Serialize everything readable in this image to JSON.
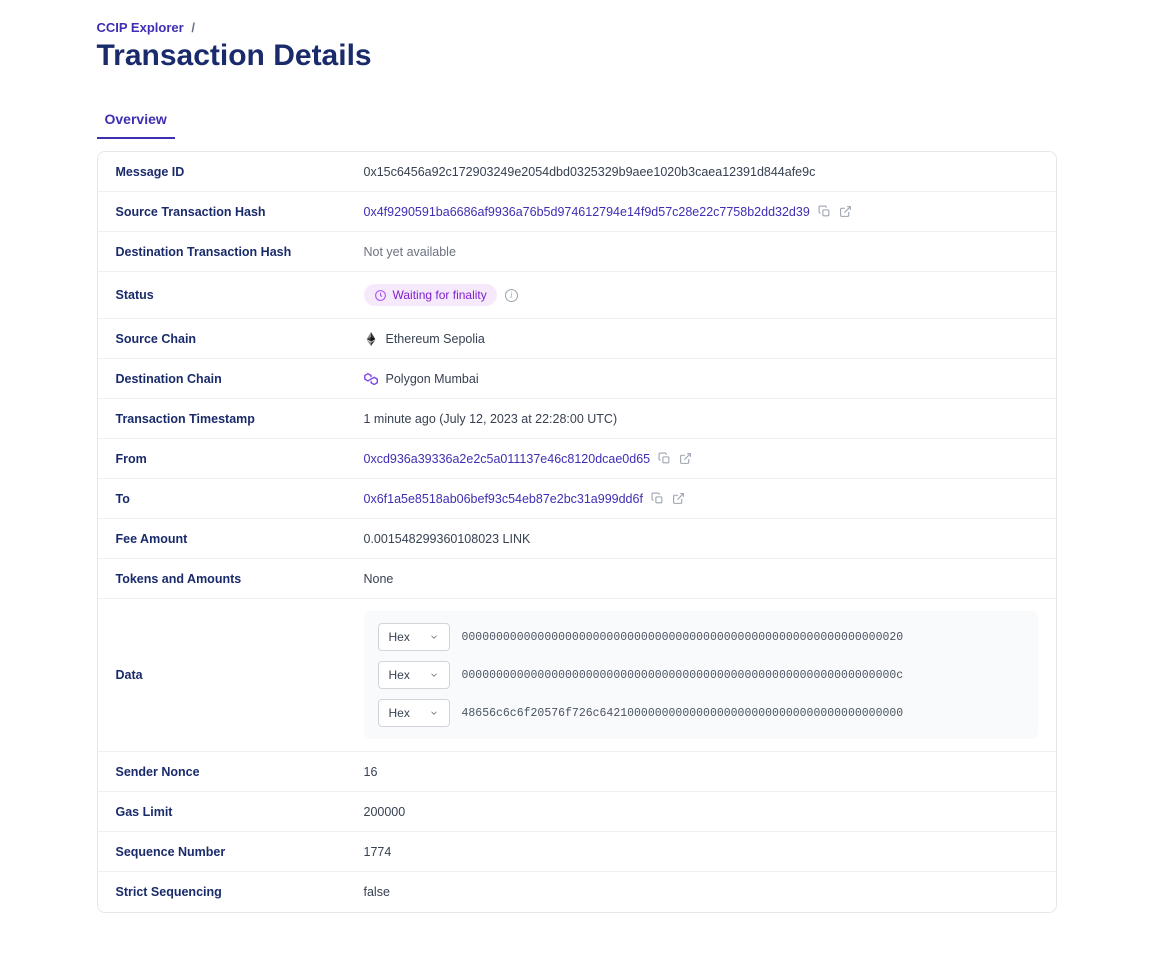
{
  "breadcrumb": {
    "root": "CCIP Explorer",
    "sep": "/"
  },
  "page_title": "Transaction Details",
  "tabs": {
    "overview": "Overview"
  },
  "labels": {
    "message_id": "Message ID",
    "source_tx_hash": "Source Transaction Hash",
    "dest_tx_hash": "Destination Transaction Hash",
    "status": "Status",
    "source_chain": "Source Chain",
    "dest_chain": "Destination Chain",
    "tx_timestamp": "Transaction Timestamp",
    "from": "From",
    "to": "To",
    "fee_amount": "Fee Amount",
    "tokens_amounts": "Tokens and Amounts",
    "data": "Data",
    "sender_nonce": "Sender Nonce",
    "gas_limit": "Gas Limit",
    "sequence_number": "Sequence Number",
    "strict_sequencing": "Strict Sequencing"
  },
  "values": {
    "message_id": "0x15c6456a92c172903249e2054dbd0325329b9aee1020b3caea12391d844afe9c",
    "source_tx_hash": "0x4f9290591ba6686af9936a76b5d974612794e14f9d57c28e22c7758b2dd32d39",
    "dest_tx_hash": "Not yet available",
    "status": "Waiting for finality",
    "source_chain": "Ethereum Sepolia",
    "dest_chain": "Polygon Mumbai",
    "tx_timestamp": "1 minute ago (July 12, 2023 at 22:28:00 UTC)",
    "from": "0xcd936a39336a2e2c5a011137e46c8120dcae0d65",
    "to": "0x6f1a5e8518ab06bef93c54eb87e2bc31a999dd6f",
    "fee_amount": "0.001548299360108023 LINK",
    "tokens_amounts": "None",
    "sender_nonce": "16",
    "gas_limit": "200000",
    "sequence_number": "1774",
    "strict_sequencing": "false"
  },
  "data_rows": [
    {
      "format": "Hex",
      "value": "0000000000000000000000000000000000000000000000000000000000000020"
    },
    {
      "format": "Hex",
      "value": "000000000000000000000000000000000000000000000000000000000000000c"
    },
    {
      "format": "Hex",
      "value": "48656c6c6f20576f726c64210000000000000000000000000000000000000000"
    }
  ]
}
